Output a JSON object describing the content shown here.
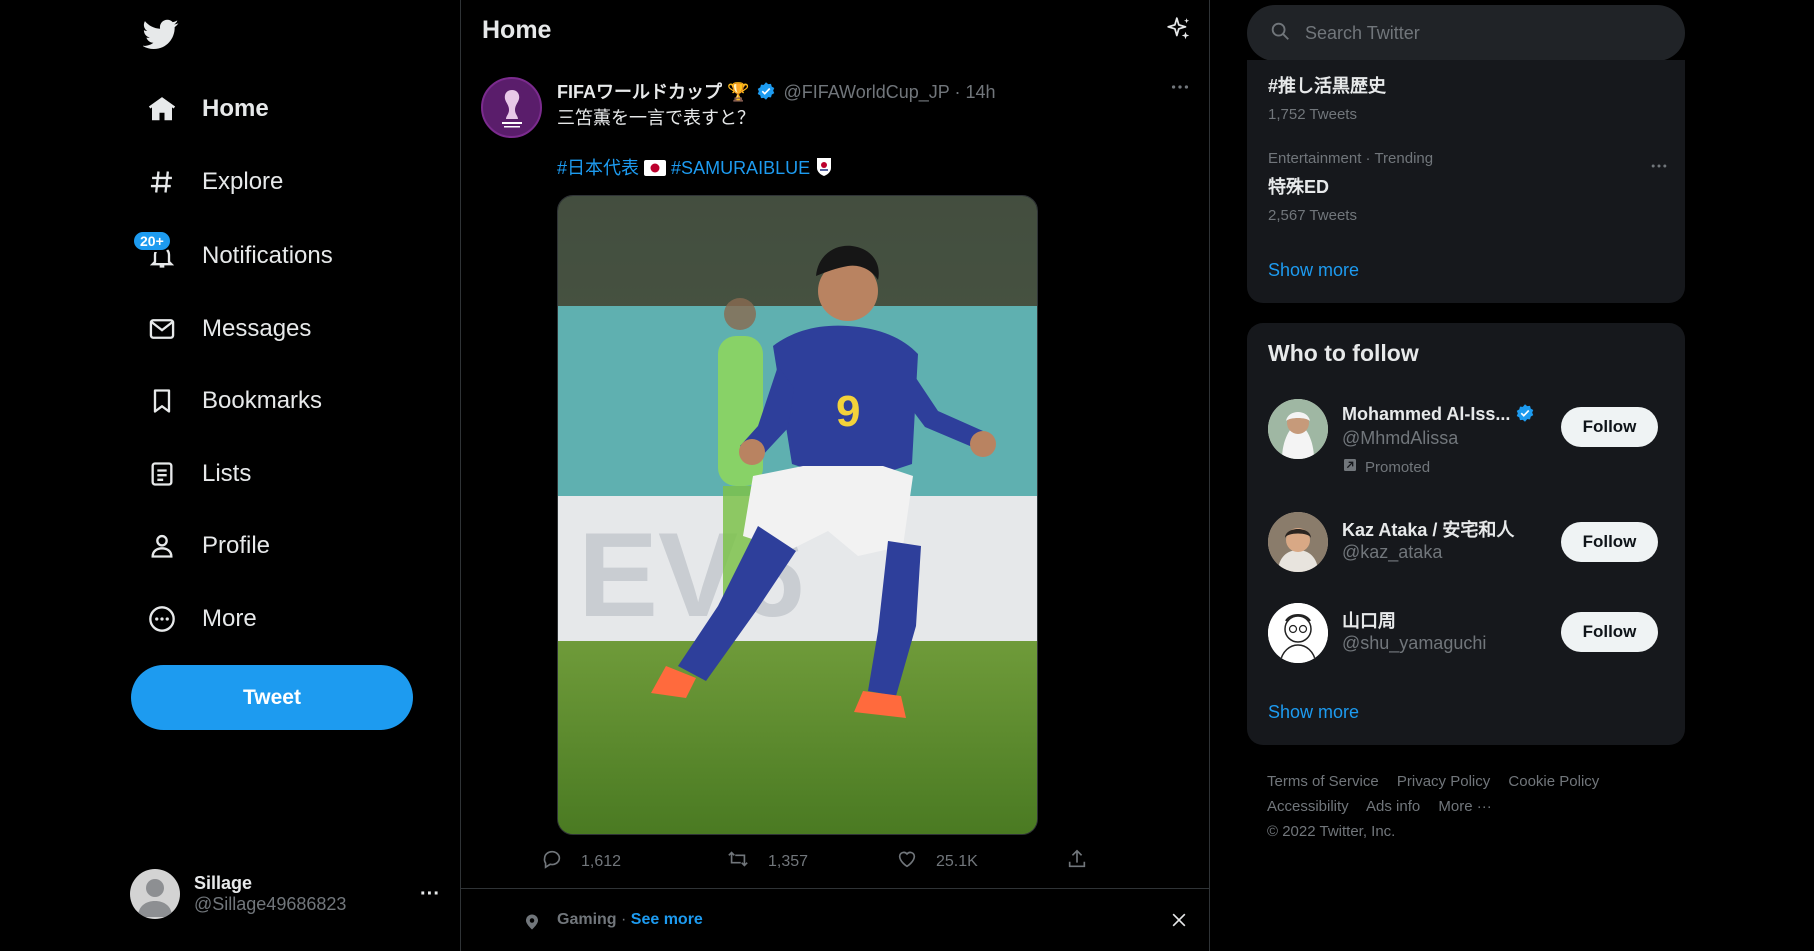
{
  "nav": {
    "items": [
      {
        "label": "Home",
        "icon": "home-icon"
      },
      {
        "label": "Explore",
        "icon": "hashtag-icon"
      },
      {
        "label": "Notifications",
        "icon": "bell-icon"
      },
      {
        "label": "Messages",
        "icon": "envelope-icon"
      },
      {
        "label": "Bookmarks",
        "icon": "bookmark-icon"
      },
      {
        "label": "Lists",
        "icon": "list-icon"
      },
      {
        "label": "Profile",
        "icon": "person-icon"
      },
      {
        "label": "More",
        "icon": "more-circle-icon"
      }
    ],
    "notif_badge": "20+",
    "tweet_button": "Tweet",
    "account": {
      "name": "Sillage",
      "handle": "@Sillage49686823",
      "more": "···"
    }
  },
  "timeline": {
    "title": "Home",
    "tweet": {
      "name": "FIFAワールドカップ 🏆",
      "handle": "@FIFAWorldCup_JP",
      "dot": "·",
      "time": "14h",
      "text": "三笘薫を一言で表すと？",
      "tag1": "#日本代表",
      "tag2": "#SAMURAIBLUE",
      "image_number": "9",
      "replies": "1,612",
      "retweets": "1,357",
      "likes": "25.1K"
    },
    "topic": {
      "category": "Gaming",
      "dot": " · ",
      "see_more": "See more"
    }
  },
  "sidebar": {
    "search_placeholder": "Search Twitter",
    "trends": [
      {
        "meta": "",
        "name": "#推し活黒歴史",
        "count": "1,752 Tweets"
      },
      {
        "meta": "Entertainment · Trending",
        "name": "特殊ED",
        "count": "2,567 Tweets"
      }
    ],
    "trends_show_more": "Show more",
    "who_title": "Who to follow",
    "who": [
      {
        "name": "Mohammed Al-Iss...",
        "handle": "@MhmdAlissa",
        "promoted": "Promoted",
        "button": "Follow"
      },
      {
        "name": "Kaz Ataka / 安宅和人",
        "handle": "@kaz_ataka",
        "button": "Follow"
      },
      {
        "name": "山口周",
        "handle": "@shu_yamaguchi",
        "button": "Follow"
      }
    ],
    "who_show_more": "Show more",
    "footer": {
      "links1": [
        "Terms of Service",
        "Privacy Policy",
        "Cookie Policy"
      ],
      "links2": [
        "Accessibility",
        "Ads info",
        "More ···"
      ],
      "copyright": "© 2022 Twitter, Inc."
    }
  },
  "colors": {
    "accent": "#1d9bf0",
    "bg": "#000000",
    "panel": "#16181c",
    "text": "#e7e9ea",
    "muted": "#71767b"
  }
}
